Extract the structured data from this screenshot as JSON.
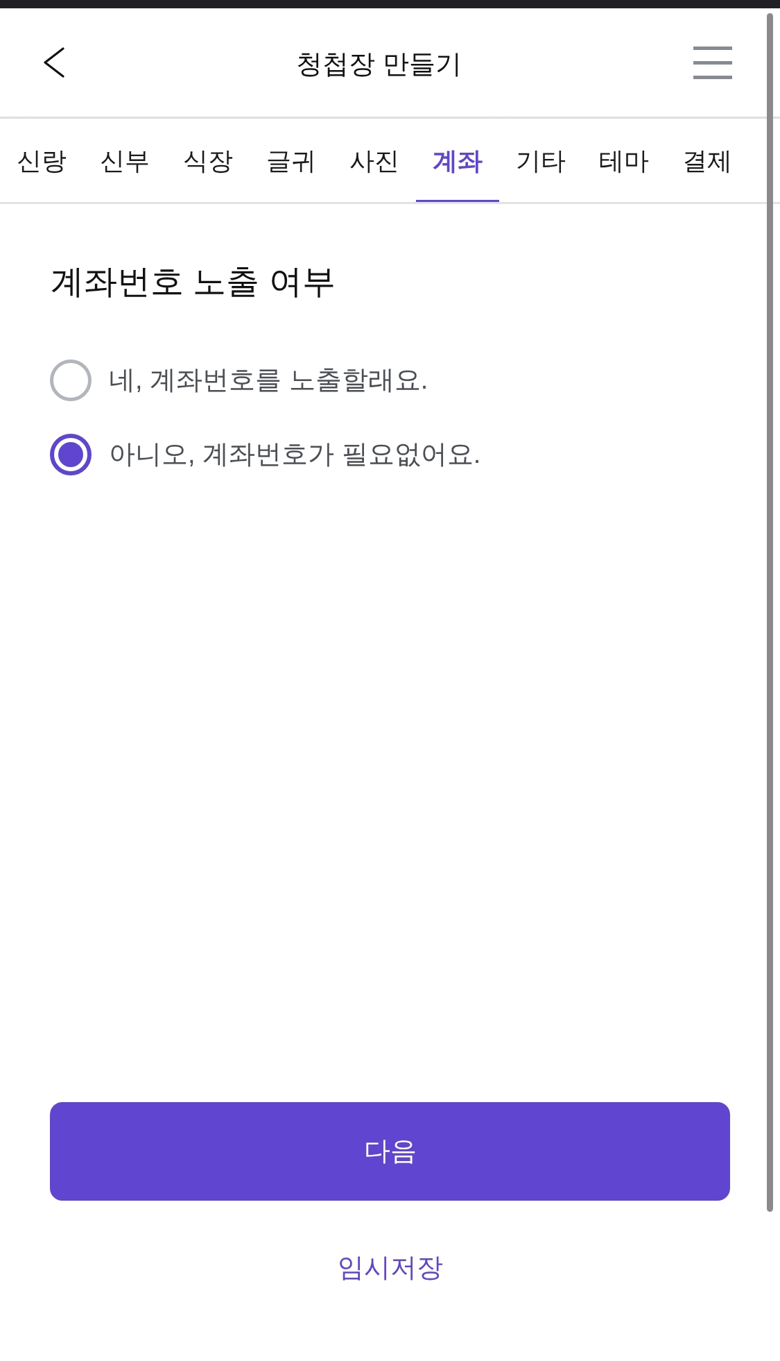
{
  "header": {
    "title": "청첩장 만들기"
  },
  "tabs": [
    {
      "label": "신랑",
      "selected": false
    },
    {
      "label": "신부",
      "selected": false
    },
    {
      "label": "식장",
      "selected": false
    },
    {
      "label": "글귀",
      "selected": false
    },
    {
      "label": "사진",
      "selected": false
    },
    {
      "label": "계좌",
      "selected": true
    },
    {
      "label": "기타",
      "selected": false
    },
    {
      "label": "테마",
      "selected": false
    },
    {
      "label": "결제",
      "selected": false
    }
  ],
  "section": {
    "title": "계좌번호 노출 여부",
    "options": [
      {
        "label": "네, 계좌번호를 노출할래요.",
        "selected": false
      },
      {
        "label": "아니오, 계좌번호가 필요없어요.",
        "selected": true
      }
    ]
  },
  "primary_button": {
    "label": "다음"
  },
  "secondary_link": {
    "label": "임시저장"
  }
}
